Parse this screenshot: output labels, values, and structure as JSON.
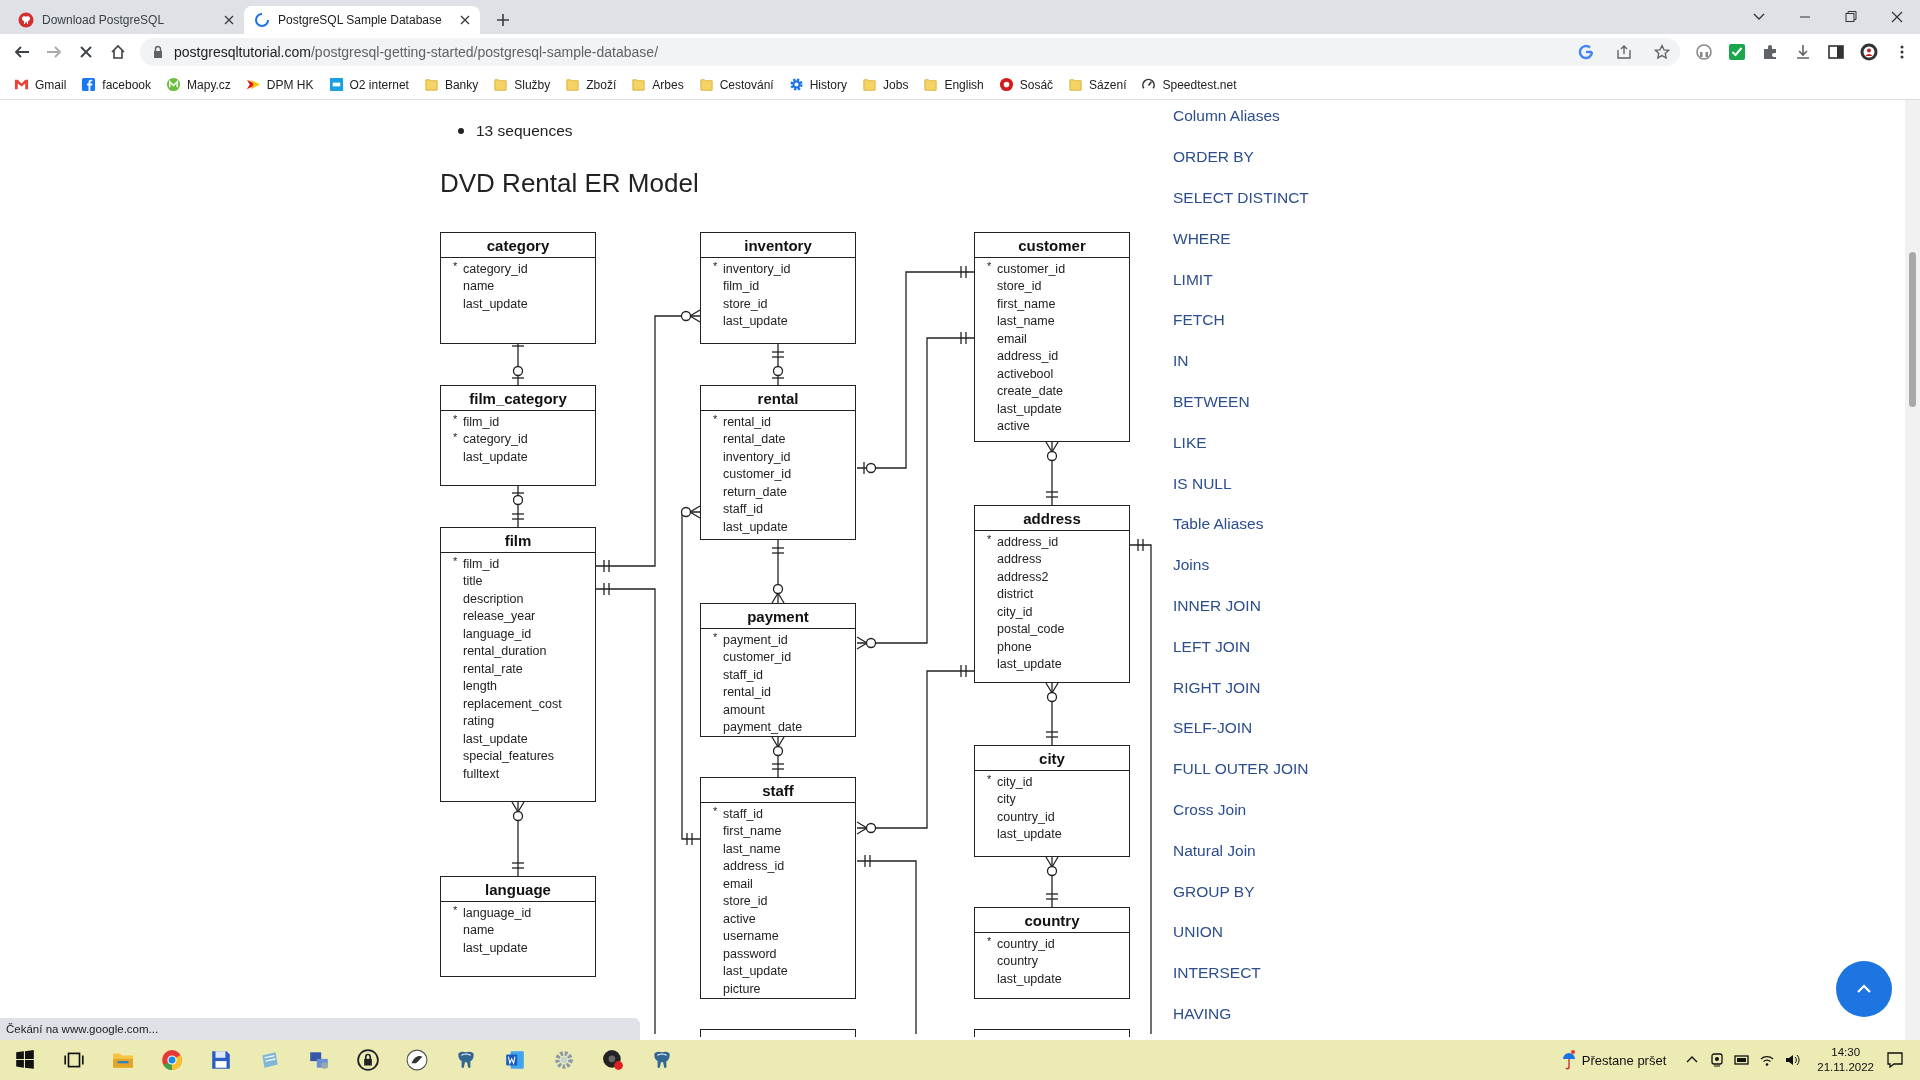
{
  "browser": {
    "tabs": [
      {
        "title": "Download PostgreSQL",
        "selected": false,
        "kind": "pg"
      },
      {
        "title": "PostgreSQL Sample Database",
        "selected": true,
        "kind": "loading"
      }
    ],
    "address": {
      "host": "postgresqltutorial.com",
      "path": "/postgresql-getting-started/postgresql-sample-database/"
    },
    "bookmarks": [
      {
        "label": "Gmail",
        "kind": "gmail"
      },
      {
        "label": "facebook",
        "kind": "facebook"
      },
      {
        "label": "Mapy.cz",
        "kind": "mapy"
      },
      {
        "label": "DPM HK",
        "kind": "dpm"
      },
      {
        "label": "O2 internet",
        "kind": "o2"
      },
      {
        "label": "Banky",
        "kind": "folder"
      },
      {
        "label": "Služby",
        "kind": "folder"
      },
      {
        "label": "Zboží",
        "kind": "folder"
      },
      {
        "label": "Arbes",
        "kind": "folder"
      },
      {
        "label": "Cestování",
        "kind": "folder"
      },
      {
        "label": "History",
        "kind": "gear"
      },
      {
        "label": "Jobs",
        "kind": "folder"
      },
      {
        "label": "English",
        "kind": "folder"
      },
      {
        "label": "Sosáč",
        "kind": "sosac"
      },
      {
        "label": "Sázení",
        "kind": "folder"
      },
      {
        "label": "Speedtest.net",
        "kind": "speedtest"
      }
    ]
  },
  "article": {
    "bullet": "13 sequences",
    "heading": "DVD Rental ER Model",
    "entities": [
      {
        "name": "category",
        "fields": [
          {
            "mark": "*",
            "name": "category_id"
          },
          {
            "name": "name"
          },
          {
            "name": "last_update"
          }
        ]
      },
      {
        "name": "film_category",
        "fields": [
          {
            "mark": "*",
            "name": "film_id"
          },
          {
            "mark": "*",
            "name": "category_id"
          },
          {
            "name": "last_update"
          }
        ]
      },
      {
        "name": "film",
        "fields": [
          {
            "mark": "*",
            "name": "film_id"
          },
          {
            "name": "title"
          },
          {
            "name": "description"
          },
          {
            "name": "release_year"
          },
          {
            "name": "language_id"
          },
          {
            "name": "rental_duration"
          },
          {
            "name": "rental_rate"
          },
          {
            "name": "length"
          },
          {
            "name": "replacement_cost"
          },
          {
            "name": "rating"
          },
          {
            "name": "last_update"
          },
          {
            "name": "special_features"
          },
          {
            "name": "fulltext"
          }
        ]
      },
      {
        "name": "language",
        "fields": [
          {
            "mark": "*",
            "name": "language_id"
          },
          {
            "name": "name"
          },
          {
            "name": "last_update"
          }
        ]
      },
      {
        "name": "inventory",
        "fields": [
          {
            "mark": "*",
            "name": "inventory_id"
          },
          {
            "name": "film_id"
          },
          {
            "name": "store_id"
          },
          {
            "name": "last_update"
          }
        ]
      },
      {
        "name": "rental",
        "fields": [
          {
            "mark": "*",
            "name": "rental_id"
          },
          {
            "name": "rental_date"
          },
          {
            "name": "inventory_id"
          },
          {
            "name": "customer_id"
          },
          {
            "name": "return_date"
          },
          {
            "name": "staff_id"
          },
          {
            "name": "last_update"
          }
        ]
      },
      {
        "name": "payment",
        "fields": [
          {
            "mark": "*",
            "name": "payment_id"
          },
          {
            "name": "customer_id"
          },
          {
            "name": "staff_id"
          },
          {
            "name": "rental_id"
          },
          {
            "name": "amount"
          },
          {
            "name": "payment_date"
          }
        ]
      },
      {
        "name": "staff",
        "fields": [
          {
            "mark": "*",
            "name": "staff_id"
          },
          {
            "name": "first_name"
          },
          {
            "name": "last_name"
          },
          {
            "name": "address_id"
          },
          {
            "name": "email"
          },
          {
            "name": "store_id"
          },
          {
            "name": "active"
          },
          {
            "name": "username"
          },
          {
            "name": "password"
          },
          {
            "name": "last_update"
          },
          {
            "name": "picture"
          }
        ]
      },
      {
        "name": "customer",
        "fields": [
          {
            "mark": "*",
            "name": "customer_id"
          },
          {
            "name": "store_id"
          },
          {
            "name": "first_name"
          },
          {
            "name": "last_name"
          },
          {
            "name": "email"
          },
          {
            "name": "address_id"
          },
          {
            "name": "activebool"
          },
          {
            "name": "create_date"
          },
          {
            "name": "last_update"
          },
          {
            "name": "active"
          }
        ]
      },
      {
        "name": "address",
        "fields": [
          {
            "mark": "*",
            "name": "address_id"
          },
          {
            "name": "address"
          },
          {
            "name": "address2"
          },
          {
            "name": "district"
          },
          {
            "name": "city_id"
          },
          {
            "name": "postal_code"
          },
          {
            "name": "phone"
          },
          {
            "name": "last_update"
          }
        ]
      },
      {
        "name": "city",
        "fields": [
          {
            "mark": "*",
            "name": "city_id"
          },
          {
            "name": "city"
          },
          {
            "name": "country_id"
          },
          {
            "name": "last_update"
          }
        ]
      },
      {
        "name": "country",
        "fields": [
          {
            "mark": "*",
            "name": "country_id"
          },
          {
            "name": "country"
          },
          {
            "name": "last_update"
          }
        ]
      }
    ],
    "relationships": [
      {
        "ends": [
          {
            "kind": "one"
          },
          {
            "kind": "zero_or_one"
          }
        ]
      },
      {
        "ends": [
          {
            "kind": "zero_or_one"
          },
          {
            "kind": "one"
          }
        ]
      },
      {
        "ends": [
          {
            "kind": "zero_or_many"
          },
          {
            "kind": "one"
          }
        ]
      },
      {
        "ends": [
          {
            "kind": "one"
          },
          {
            "kind": "zero_or_many"
          }
        ]
      },
      {
        "ends": [
          {
            "kind": "one"
          }
        ]
      },
      {
        "ends": [
          {
            "kind": "one"
          },
          {
            "kind": "zero_or_one"
          }
        ]
      },
      {
        "ends": [
          {
            "kind": "zero_or_many"
          },
          {
            "kind": "one"
          }
        ]
      },
      {
        "ends": [
          {
            "kind": "one"
          },
          {
            "kind": "zero_or_many"
          }
        ]
      },
      {
        "ends": [
          {
            "kind": "zero_or_many"
          },
          {
            "kind": "one"
          }
        ]
      },
      {
        "ends": [
          {
            "kind": "zero_or_one"
          },
          {
            "kind": "one"
          }
        ]
      },
      {
        "ends": [
          {
            "kind": "zero_or_many"
          },
          {
            "kind": "one"
          }
        ]
      },
      {
        "ends": [
          {
            "kind": "zero_or_many"
          },
          {
            "kind": "one"
          }
        ]
      },
      {
        "ends": [
          {
            "kind": "one"
          }
        ]
      },
      {
        "ends": [
          {
            "kind": "zero_or_many"
          },
          {
            "kind": "one"
          }
        ]
      },
      {
        "ends": [
          {
            "kind": "zero_or_many"
          },
          {
            "kind": "one"
          }
        ]
      },
      {
        "ends": [
          {
            "kind": "zero_or_many"
          },
          {
            "kind": "one"
          }
        ]
      },
      {
        "ends": [
          {
            "kind": "one"
          }
        ]
      }
    ]
  },
  "sidebar": {
    "items": [
      "Column Aliases",
      "ORDER BY",
      "SELECT DISTINCT",
      "WHERE",
      "LIMIT",
      "FETCH",
      "IN",
      "BETWEEN",
      "LIKE",
      "IS NULL",
      "Table Aliases",
      "Joins",
      "INNER JOIN",
      "LEFT JOIN",
      "RIGHT JOIN",
      "SELF-JOIN",
      "FULL OUTER JOIN",
      "Cross Join",
      "Natural Join",
      "GROUP BY",
      "UNION",
      "INTERSECT",
      "HAVING"
    ]
  },
  "status_bubble": "Čekání na www.google.com...",
  "taskbar": {
    "apps": [
      {
        "kind": "start"
      },
      {
        "kind": "taskview"
      },
      {
        "kind": "explorer"
      },
      {
        "kind": "chrome"
      },
      {
        "kind": "floppy"
      },
      {
        "kind": "notepad"
      },
      {
        "kind": "network"
      },
      {
        "kind": "lock"
      },
      {
        "kind": "bird"
      },
      {
        "kind": "elephant"
      },
      {
        "kind": "word"
      },
      {
        "kind": "settings"
      },
      {
        "kind": "recorder"
      },
      {
        "kind": "elephant"
      }
    ],
    "weather": "Přestane pršet",
    "time": "14:30",
    "date": "21.11.2022"
  }
}
